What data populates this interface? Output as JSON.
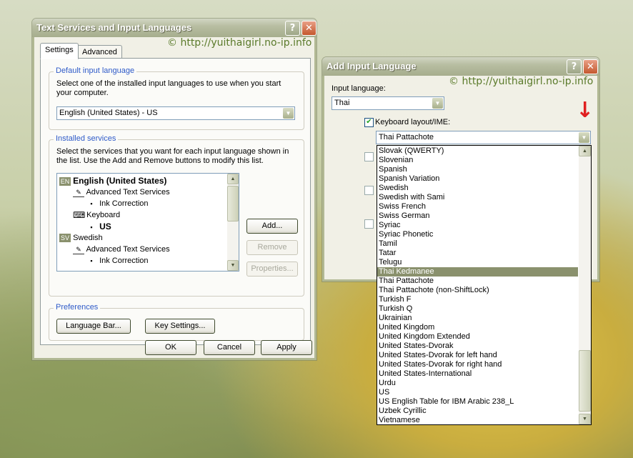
{
  "left_dialog": {
    "title": "Text Services and Input Languages",
    "watermark": "© http://yuithaigirl.no-ip.info",
    "tabs": [
      "Settings",
      "Advanced"
    ],
    "default_group": {
      "legend": "Default input language",
      "description": "Select one of the installed input languages to use when you start your computer.",
      "selected": "English (United States) - US"
    },
    "services_group": {
      "legend": "Installed services",
      "description": "Select the services that you want for each input language shown in the list. Use the Add and Remove buttons to modify this list.",
      "tree": [
        {
          "level": 0,
          "badge": "EN",
          "label": "English (United States)",
          "bold": true
        },
        {
          "level": 1,
          "icon": "text-services-icon",
          "label": "Advanced Text Services"
        },
        {
          "level": 2,
          "icon": "bullet",
          "label": "Ink Correction"
        },
        {
          "level": 1,
          "icon": "keyboard-icon",
          "label": "Keyboard"
        },
        {
          "level": 2,
          "icon": "bullet",
          "label": "US",
          "bold": true
        },
        {
          "level": 0,
          "badge": "SV",
          "label": "Swedish"
        },
        {
          "level": 1,
          "icon": "text-services-icon",
          "label": "Advanced Text Services"
        },
        {
          "level": 2,
          "icon": "bullet",
          "label": "Ink Correction"
        }
      ],
      "buttons": {
        "add": "Add...",
        "remove": "Remove",
        "properties": "Properties..."
      }
    },
    "preferences_group": {
      "legend": "Preferences",
      "language_bar": "Language Bar...",
      "key_settings": "Key Settings..."
    },
    "footer": {
      "ok": "OK",
      "cancel": "Cancel",
      "apply": "Apply"
    }
  },
  "right_dialog": {
    "title": "Add Input Language",
    "watermark": "© http://yuithaigirl.no-ip.info",
    "input_language_label": "Input language:",
    "input_language_value": "Thai",
    "keyboard_layout_label": "Keyboard layout/IME:",
    "keyboard_layout_value": "Thai Pattachote",
    "arrow_color": "#e02020",
    "dropdown_items": [
      "Slovak (QWERTY)",
      "Slovenian",
      "Spanish",
      "Spanish Variation",
      "Swedish",
      "Swedish with Sami",
      "Swiss French",
      "Swiss German",
      "Syriac",
      "Syriac Phonetic",
      "Tamil",
      "Tatar",
      "Telugu",
      "Thai Kedmanee",
      "Thai Pattachote",
      "Thai Pattachote (non-ShiftLock)",
      "Turkish F",
      "Turkish Q",
      "Ukrainian",
      "United Kingdom",
      "United Kingdom Extended",
      "United States-Dvorak",
      "United States-Dvorak for left hand",
      "United States-Dvorak for right hand",
      "United States-International",
      "Urdu",
      "US",
      "US English Table for IBM Arabic 238_L",
      "Uzbek Cyrillic",
      "Vietnamese"
    ],
    "selected_index": 13
  },
  "icons": {
    "help": "?",
    "close": "✕",
    "dropdown_arrow": "▼",
    "scroll_up": "▲",
    "scroll_down": "▼",
    "check": "✔",
    "keyboard": "⌨",
    "red_arrow": "↓"
  }
}
